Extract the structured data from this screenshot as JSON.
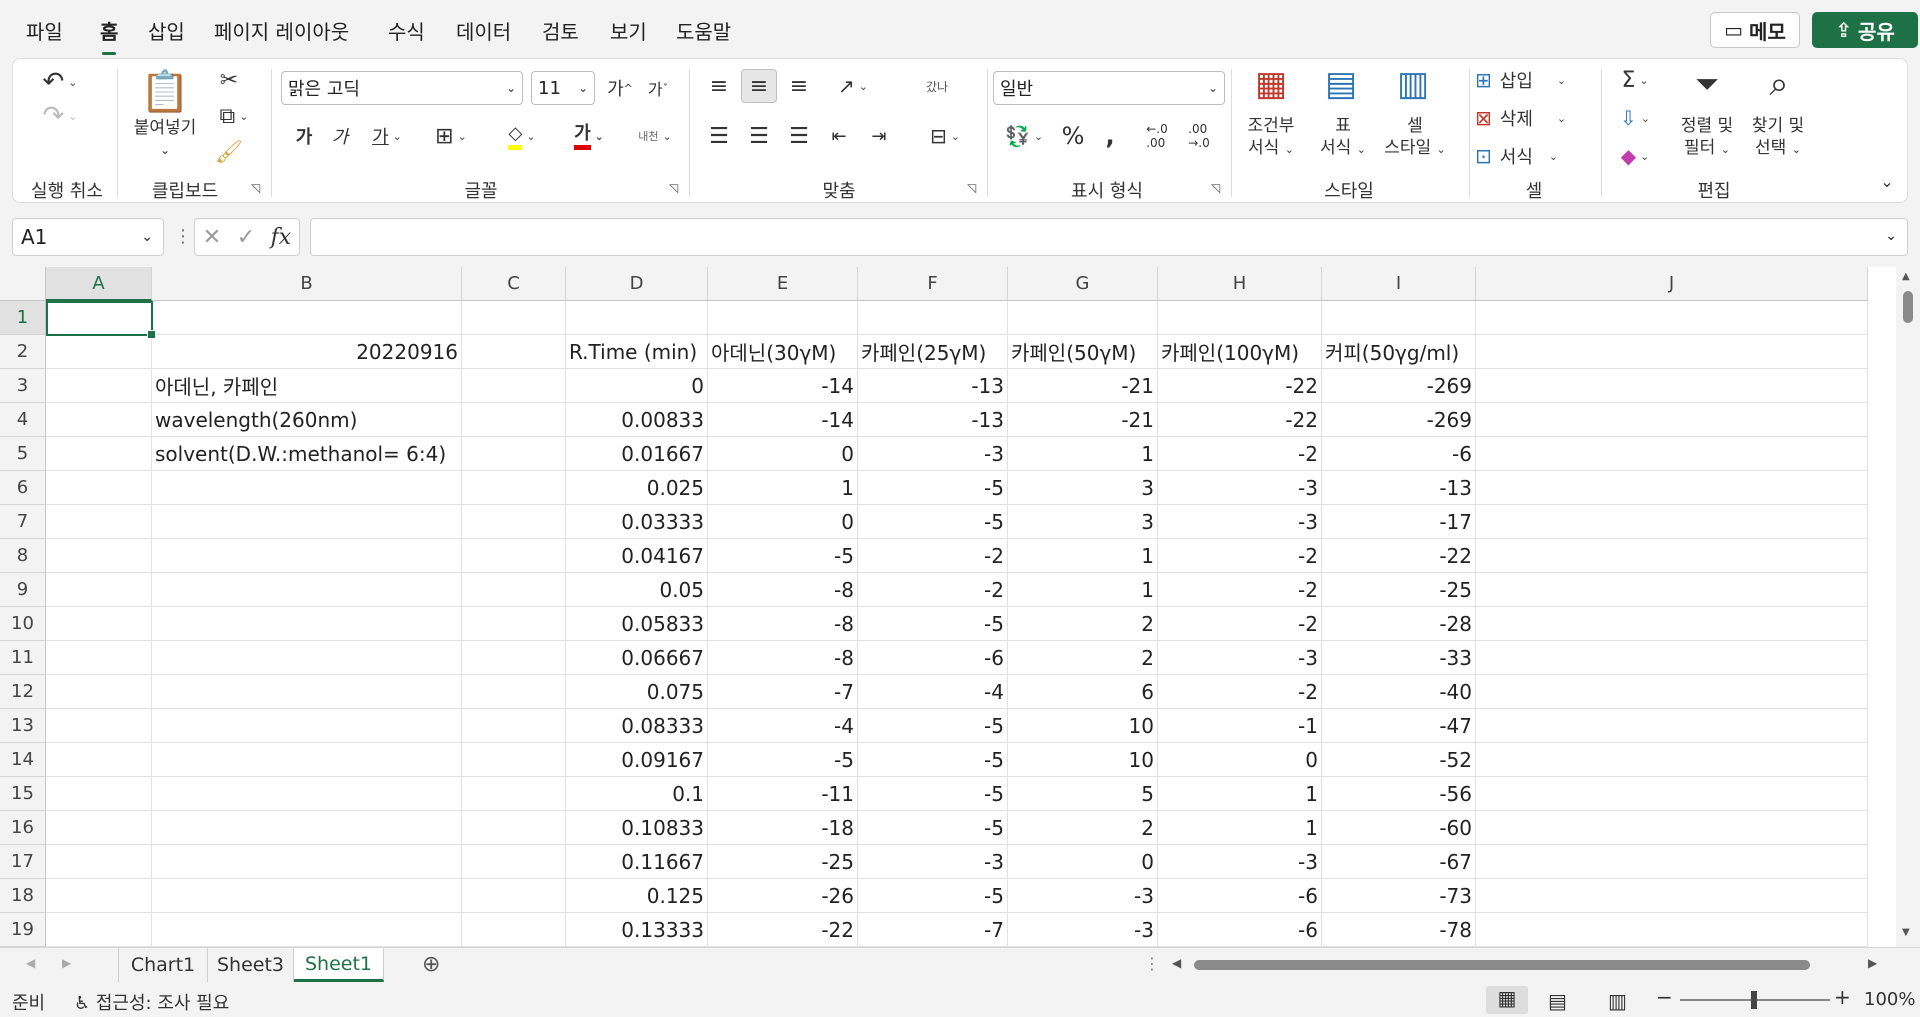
{
  "menu": {
    "items": [
      "파일",
      "홈",
      "삽입",
      "페이지 레이아웃",
      "수식",
      "데이터",
      "검토",
      "보기",
      "도움말"
    ],
    "active": "홈",
    "memo": "메모",
    "share": "공유"
  },
  "ribbon": {
    "undo_group": "실행 취소",
    "clipboard_group": "클립보드",
    "paste_label": "붙여넣기",
    "font_group": "글꼴",
    "font_name": "맑은 고딕",
    "font_size": "11",
    "increase_font": "가",
    "decrease_font": "가",
    "bold": "가",
    "italic": "가",
    "underline": "가",
    "font_color_glyph": "가",
    "phonetic": "내천",
    "align_group": "맞춤",
    "wrap_glyph": "갔나",
    "number_group": "표시 형식",
    "number_format": "일반",
    "style_group": "스타일",
    "cond_format": [
      "조건부",
      "서식"
    ],
    "table_format": [
      "표",
      "서식"
    ],
    "cell_style": [
      "셀",
      "스타일"
    ],
    "cells_group": "셀",
    "insert": "삽입",
    "delete": "삭제",
    "format": "서식",
    "edit_group": "편집",
    "sort_filter": [
      "정렬 및",
      "필터"
    ],
    "find_select": [
      "찾기 및",
      "선택"
    ]
  },
  "formula_bar": {
    "name_box": "A1",
    "fx": "fx",
    "content": ""
  },
  "grid": {
    "columns": [
      "A",
      "B",
      "C",
      "D",
      "E",
      "F",
      "G",
      "H",
      "I",
      "J"
    ],
    "rows": [
      "1",
      "2",
      "3",
      "4",
      "5",
      "6",
      "7",
      "8",
      "9",
      "10",
      "11",
      "12",
      "13",
      "14",
      "15",
      "16",
      "17",
      "18",
      "19"
    ],
    "b2": "20220916",
    "b3": "아데닌, 카페인",
    "b4": "wavelength(260nm)",
    "b5": "solvent(D.W.:methanol=  6:4)",
    "headers": [
      "R.Time (min)",
      "아데닌(30γM)",
      "카페인(25γM)",
      "카페인(50γM)",
      "카페인(100γM)",
      "커피(50γg/ml)"
    ],
    "data": [
      [
        "0",
        "-14",
        "-13",
        "-21",
        "-22",
        "-269"
      ],
      [
        "0.00833",
        "-14",
        "-13",
        "-21",
        "-22",
        "-269"
      ],
      [
        "0.01667",
        "0",
        "-3",
        "1",
        "-2",
        "-6"
      ],
      [
        "0.025",
        "1",
        "-5",
        "3",
        "-3",
        "-13"
      ],
      [
        "0.03333",
        "0",
        "-5",
        "3",
        "-3",
        "-17"
      ],
      [
        "0.04167",
        "-5",
        "-2",
        "1",
        "-2",
        "-22"
      ],
      [
        "0.05",
        "-8",
        "-2",
        "1",
        "-2",
        "-25"
      ],
      [
        "0.05833",
        "-8",
        "-5",
        "2",
        "-2",
        "-28"
      ],
      [
        "0.06667",
        "-8",
        "-6",
        "2",
        "-3",
        "-33"
      ],
      [
        "0.075",
        "-7",
        "-4",
        "6",
        "-2",
        "-40"
      ],
      [
        "0.08333",
        "-4",
        "-5",
        "10",
        "-1",
        "-47"
      ],
      [
        "0.09167",
        "-5",
        "-5",
        "10",
        "0",
        "-52"
      ],
      [
        "0.1",
        "-11",
        "-5",
        "5",
        "1",
        "-56"
      ],
      [
        "0.10833",
        "-18",
        "-5",
        "2",
        "1",
        "-60"
      ],
      [
        "0.11667",
        "-25",
        "-3",
        "0",
        "-3",
        "-67"
      ],
      [
        "0.125",
        "-26",
        "-5",
        "-3",
        "-6",
        "-73"
      ],
      [
        "0.13333",
        "-22",
        "-7",
        "-3",
        "-6",
        "-78"
      ]
    ]
  },
  "sheets": {
    "tabs": [
      "Chart1",
      "Sheet3",
      "Sheet1"
    ],
    "active": "Sheet1"
  },
  "status": {
    "ready": "준비",
    "accessibility": "접근성: 조사 필요",
    "zoom": "100%"
  }
}
